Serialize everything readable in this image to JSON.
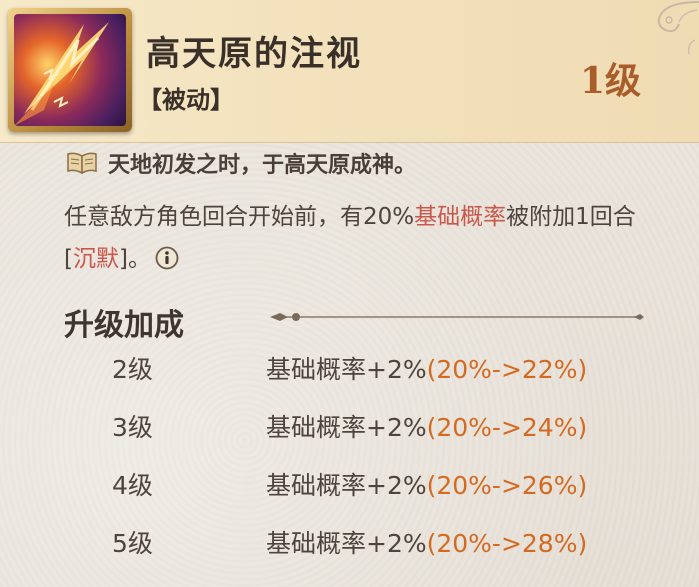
{
  "skill": {
    "name": "高天原的注视",
    "type": "【被动】",
    "level": "1级",
    "icon": "lightning-spear-icon"
  },
  "flavor": {
    "icon": "book-icon",
    "text": "天地初发之时，于高天原成神。"
  },
  "description": {
    "part1": "任意敌方角色回合开始前，有20%",
    "highlight1": "基础概率",
    "part2": "被附加1回合[",
    "highlight2": "沉默",
    "part3": "]。",
    "info_icon": "info-icon"
  },
  "upgrade": {
    "title": "升级加成",
    "levels": [
      {
        "level": "2级",
        "effect": "基础概率+2%",
        "range": "(20%->22%)"
      },
      {
        "level": "3级",
        "effect": "基础概率+2%",
        "range": "(20%->24%)"
      },
      {
        "level": "4级",
        "effect": "基础概率+2%",
        "range": "(20%->26%)"
      },
      {
        "level": "5级",
        "effect": "基础概率+2%",
        "range": "(20%->28%)"
      }
    ]
  },
  "colors": {
    "highlight": "#c8574c",
    "range": "#d46a22",
    "level_badge": "#a85d2a"
  }
}
